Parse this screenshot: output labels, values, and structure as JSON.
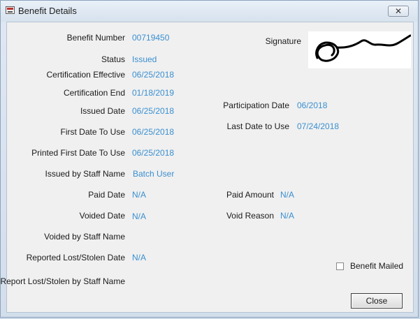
{
  "window": {
    "title": "Benefit Details",
    "close_glyph": "✕"
  },
  "fields": {
    "benefit_number": {
      "label": "Benefit Number",
      "value": "00719450"
    },
    "status": {
      "label": "Status",
      "value": "Issued"
    },
    "certification_effective": {
      "label": "Certification Effective",
      "value": "06/25/2018"
    },
    "certification_end": {
      "label": "Certification End",
      "value": "01/18/2019"
    },
    "issued_date": {
      "label": "Issued Date",
      "value": "06/25/2018"
    },
    "first_date_to_use": {
      "label": "First Date To Use",
      "value": "06/25/2018"
    },
    "printed_first_date_to_use": {
      "label": "Printed First Date To Use",
      "value": "06/25/2018"
    },
    "issued_by_staff_name": {
      "label": "Issued by Staff Name",
      "value": "Batch User"
    },
    "paid_date": {
      "label": "Paid Date",
      "value": "N/A"
    },
    "voided_date": {
      "label": "Voided Date",
      "value": "N/A"
    },
    "voided_by_staff_name": {
      "label": "Voided by Staff Name",
      "value": ""
    },
    "reported_lost_stolen_date": {
      "label": "Reported Lost/Stolen Date",
      "value": "N/A"
    },
    "report_lost_stolen_by_staff_name": {
      "label": "Report Lost/Stolen by Staff Name",
      "value": ""
    },
    "signature": {
      "label": "Signature"
    },
    "participation_date": {
      "label": "Participation Date",
      "value": "06/2018"
    },
    "last_date_to_use": {
      "label": "Last Date to Use",
      "value": "07/24/2018"
    },
    "paid_amount": {
      "label": "Paid Amount",
      "value": "N/A"
    },
    "void_reason": {
      "label": "Void Reason",
      "value": "N/A"
    }
  },
  "benefit_mailed": {
    "label": "Benefit Mailed",
    "checked": false
  },
  "buttons": {
    "close": "Close"
  },
  "colors": {
    "value_text": "#3a8fd0",
    "background": "#f0f0f0"
  }
}
